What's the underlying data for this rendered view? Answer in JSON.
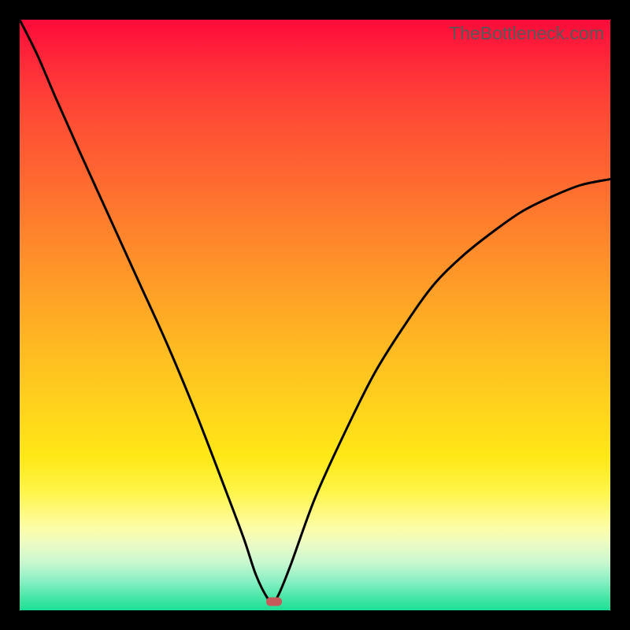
{
  "watermark": "TheBottleneck.com",
  "colors": {
    "frame": "#000000",
    "curve": "#000000",
    "marker": "#c55a5a",
    "gradient_top": "#ff0a3a",
    "gradient_bottom": "#1ddf96"
  },
  "chart_data": {
    "type": "line",
    "title": "",
    "xlabel": "",
    "ylabel": "",
    "xlim": [
      0,
      100
    ],
    "ylim": [
      0,
      100
    ],
    "grid": false,
    "legend": false,
    "notes": "V-shaped bottleneck curve on a red→green vertical gradient; marker at curve minimum",
    "min_point": {
      "x": 43,
      "y": 1.5
    },
    "series": [
      {
        "name": "bottleneck-curve",
        "x": [
          0,
          3,
          6,
          10,
          15,
          20,
          25,
          30,
          35,
          38,
          40,
          42,
          43,
          44,
          46,
          50,
          55,
          60,
          65,
          70,
          75,
          80,
          85,
          90,
          95,
          100
        ],
        "values": [
          100,
          94,
          87,
          78,
          67,
          56,
          45,
          33,
          20,
          12,
          6,
          2,
          1.5,
          3,
          8,
          19,
          30,
          40,
          48,
          55,
          60,
          64,
          67.5,
          70,
          72,
          73
        ]
      }
    ]
  }
}
